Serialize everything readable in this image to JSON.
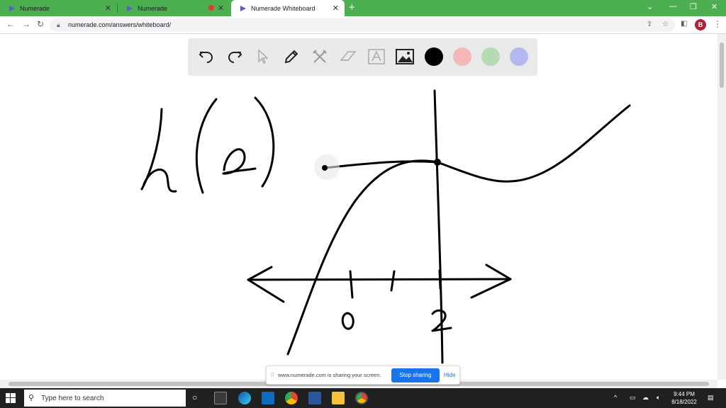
{
  "browser": {
    "tabs": [
      {
        "label": "Numerade",
        "active": false
      },
      {
        "label": "Numerade",
        "active": false
      },
      {
        "label": "Numerade Whiteboard",
        "active": true
      }
    ],
    "new_tab": "+",
    "url": "numerade.com/answers/whiteboard/",
    "profile_initial": "B",
    "accent": "#4caf50"
  },
  "whiteboard": {
    "tools": [
      "undo-icon",
      "redo-icon",
      "pointer-icon",
      "pen-icon",
      "tools-icon",
      "eraser-icon",
      "text-icon",
      "image-icon"
    ],
    "colors": [
      "#000000",
      "#f4b8b8",
      "#b5dbb5",
      "#b5b8f0"
    ],
    "handwriting": {
      "function_label": "h(2)",
      "tick_label_0": "0",
      "tick_label_2": "2"
    }
  },
  "share_bar": {
    "message": "www.numerade.com is sharing your screen.",
    "stop_label": "Stop sharing",
    "hide_label": "Hide"
  },
  "taskbar": {
    "search_placeholder": "Type here to search",
    "time": "9:44 PM",
    "date": "8/18/2022"
  }
}
